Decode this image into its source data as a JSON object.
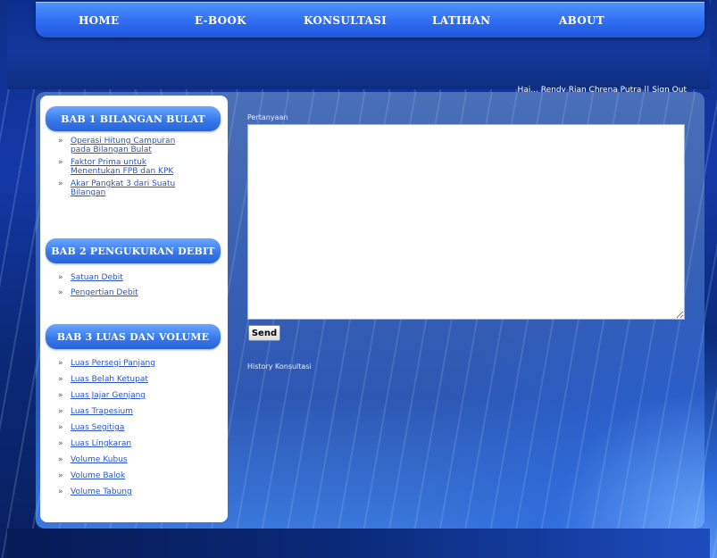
{
  "nav": {
    "items": [
      "HOME",
      "E-BOOK",
      "KONSULTASI",
      "LATIHAN",
      "ABOUT"
    ]
  },
  "userbar": {
    "greeting": "Hai... Rendy Rian Chrena Putra ||",
    "signout": "Sign Out"
  },
  "sidebar": {
    "sections": [
      {
        "title": "BAB 1 BILANGAN BULAT",
        "links": [
          [
            "Operasi Hitung Campuran",
            "pada Bilangan Bulat"
          ],
          [
            "Faktor Prima untuk",
            "Menentukan FPB dan KPK"
          ],
          [
            "Akar Pangkat 3 dari Suatu",
            "Bilangan"
          ]
        ]
      },
      {
        "title": "BAB 2 PENGUKURAN DEBIT",
        "links": [
          [
            "Satuan Debit"
          ],
          [
            "Pengertian Debit"
          ]
        ]
      },
      {
        "title": "BAB 3 LUAS DAN VOLUME",
        "links": [
          [
            "Luas Persegi Panjang"
          ],
          [
            "Luas Belah Ketupat"
          ],
          [
            "Luas Jajar Genjang"
          ],
          [
            "Luas Trapesium"
          ],
          [
            "Luas Segitiga"
          ],
          [
            "Luas Lingkaran"
          ],
          [
            "Volume Kubus"
          ],
          [
            "Volume Balok"
          ],
          [
            "Volume Tabung"
          ]
        ]
      }
    ],
    "arrow": "»"
  },
  "content": {
    "question_label": "Pertanyaan",
    "question_value": "",
    "send_label": "Send",
    "history_label": "History Konsultasi"
  }
}
